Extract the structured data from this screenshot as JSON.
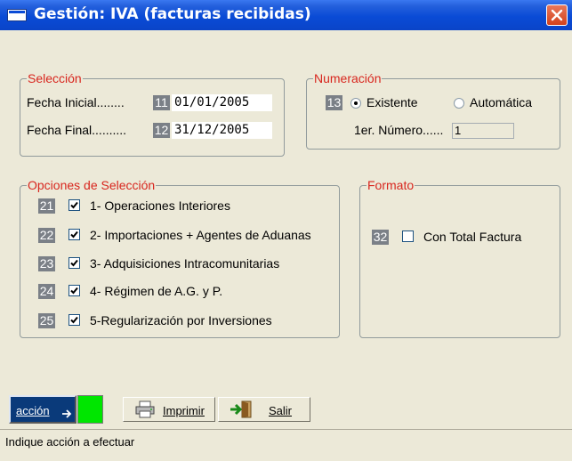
{
  "window": {
    "title": "Gestión: IVA (facturas recibidas)"
  },
  "seleccion": {
    "legend": "Selección",
    "fecha_inicial": {
      "label": "Fecha Inicial........",
      "code": "11",
      "value": "01/01/2005"
    },
    "fecha_final": {
      "label": "Fecha Final..........",
      "code": "12",
      "value": "31/12/2005"
    }
  },
  "numeracion": {
    "legend": "Numeración",
    "code": "13",
    "option_existente": "Existente",
    "option_automatica": "Automática",
    "selected": "Existente",
    "primer_numero_label": "1er. Número......",
    "primer_numero_value": "1"
  },
  "opciones": {
    "legend": "Opciones de Selección",
    "items": [
      {
        "code": "21",
        "label": "1- Operaciones Interiores",
        "checked": true
      },
      {
        "code": "22",
        "label": "2- Importaciones + Agentes de Aduanas",
        "checked": true
      },
      {
        "code": "23",
        "label": "3- Adquisiciones Intracomunitarias",
        "checked": true
      },
      {
        "code": "24",
        "label": "4- Régimen de A.G. y P.",
        "checked": true
      },
      {
        "code": "25",
        "label": "5-Regularización por Inversiones",
        "checked": true
      }
    ]
  },
  "formato": {
    "legend": "Formato",
    "code": "32",
    "label": "Con Total Factura",
    "checked": false
  },
  "toolbar": {
    "accion_label": "acción",
    "imprimir_label": "Imprimir",
    "salir_label": "Salir"
  },
  "status": {
    "text": "Indique acción a efectuar"
  },
  "colors": {
    "title_bar": "#0a4bd6",
    "legend_text": "#d8261e",
    "code_badge": "#7b8087",
    "accion_button": "#0a3a7a",
    "status_indicator": "#00e600"
  }
}
